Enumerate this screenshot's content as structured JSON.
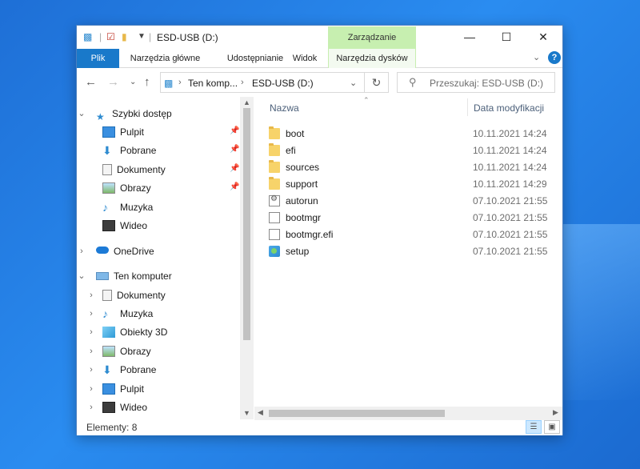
{
  "window": {
    "title": "ESD-USB (D:)",
    "context_tab_header": "Zarządzanie"
  },
  "ribbon": {
    "tabs": [
      "Plik",
      "Narzędzia główne",
      "Udostępnianie",
      "Widok",
      "Narzędzia dysków"
    ]
  },
  "address": {
    "crumbs": [
      "Ten komp...",
      "ESD-USB (D:)"
    ],
    "search_placeholder": "Przeszukaj: ESD-USB (D:)"
  },
  "nav": {
    "quick_access": "Szybki dostęp",
    "quick_items": [
      "Pulpit",
      "Pobrane",
      "Dokumenty",
      "Obrazy",
      "Muzyka",
      "Wideo"
    ],
    "onedrive": "OneDrive",
    "this_pc": "Ten komputer",
    "pc_items": [
      "Dokumenty",
      "Muzyka",
      "Obiekty 3D",
      "Obrazy",
      "Pobrane",
      "Pulpit",
      "Wideo"
    ]
  },
  "filelist": {
    "col_name": "Nazwa",
    "col_date": "Data modyfikacji",
    "files": [
      {
        "name": "boot",
        "date": "10.11.2021 14:24",
        "icon": "folder-icon"
      },
      {
        "name": "efi",
        "date": "10.11.2021 14:24",
        "icon": "folder-icon"
      },
      {
        "name": "sources",
        "date": "10.11.2021 14:24",
        "icon": "folder-icon"
      },
      {
        "name": "support",
        "date": "10.11.2021 14:29",
        "icon": "folder-icon"
      },
      {
        "name": "autorun",
        "date": "07.10.2021 21:55",
        "icon": "settings-file-icon"
      },
      {
        "name": "bootmgr",
        "date": "07.10.2021 21:55",
        "icon": "file-icon"
      },
      {
        "name": "bootmgr.efi",
        "date": "07.10.2021 21:55",
        "icon": "file-icon"
      },
      {
        "name": "setup",
        "date": "07.10.2021 21:55",
        "icon": "setup-icon"
      }
    ]
  },
  "status": {
    "items_text": "Elementy: 8"
  },
  "colors": {
    "file_tab": "#1979ca",
    "context_tab": "#c7efb0",
    "folder": "#f7d36a"
  }
}
